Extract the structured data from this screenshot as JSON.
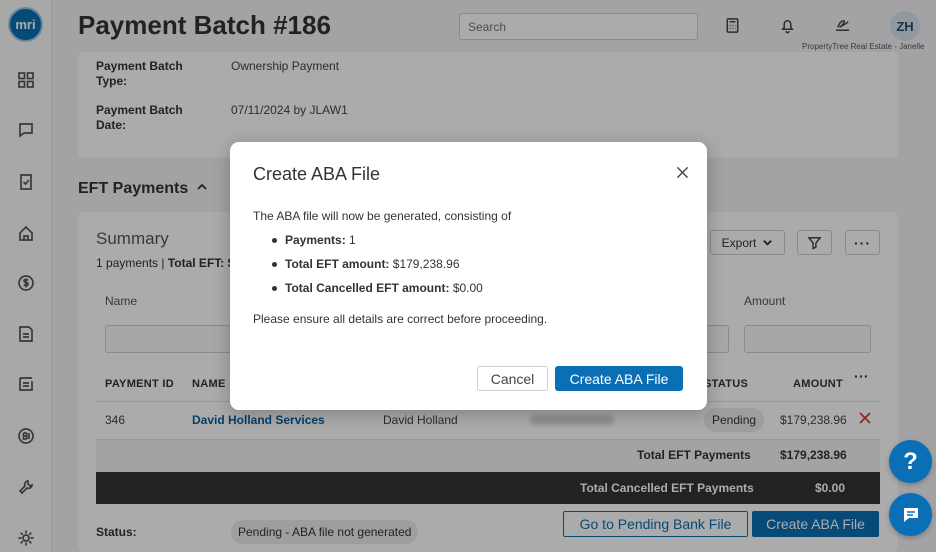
{
  "header": {
    "title": "Payment Batch #186",
    "search_placeholder": "Search",
    "avatar_initials": "ZH",
    "company": "PropertyTree Real Estate - Janelle"
  },
  "sidebar": {
    "logo": "mri"
  },
  "batch": {
    "type_label": "Payment Batch Type:",
    "type_value": "Ownership Payment",
    "date_label": "Payment Batch Date:",
    "date_value": "07/11/2024 by JLAW1"
  },
  "eft": {
    "section_title": "EFT Payments",
    "summary_title": "Summary",
    "summary_prefix": "1 payments |",
    "summary_total_label": "Total EFT: $",
    "export_label": "Export",
    "filters": {
      "name": "Name",
      "amount": "Amount"
    },
    "columns": {
      "payment_id": "PAYMENT ID",
      "name": "NAME",
      "status": "STATUS",
      "amount": "AMOUNT"
    },
    "rows": [
      {
        "payment_id": "346",
        "name": "David Holland Services",
        "contact": "David Holland",
        "status": "Pending",
        "amount": "$179,238.96"
      }
    ],
    "total_label": "Total EFT Payments",
    "total_value": "$179,238.96",
    "cancelled_label": "Total Cancelled EFT Payments",
    "cancelled_value": "$0.00"
  },
  "footer": {
    "status_label": "Status:",
    "status_value": "Pending - ABA file not generated",
    "go_button": "Go to Pending Bank File",
    "create_button": "Create ABA File"
  },
  "modal": {
    "title": "Create ABA File",
    "intro": "The ABA file will now be generated, consisting of",
    "items": [
      {
        "label": "Payments:",
        "value": "1"
      },
      {
        "label": "Total EFT amount:",
        "value": "$179,238.96"
      },
      {
        "label": "Total Cancelled EFT amount:",
        "value": "$0.00"
      }
    ],
    "note": "Please ensure all details are correct before proceeding.",
    "cancel": "Cancel",
    "confirm": "Create ABA File"
  },
  "fabs": {
    "help": "?"
  },
  "colors": {
    "primary": "#0a6fb4",
    "dark_bar": "#333333",
    "danger": "#d9352b"
  }
}
